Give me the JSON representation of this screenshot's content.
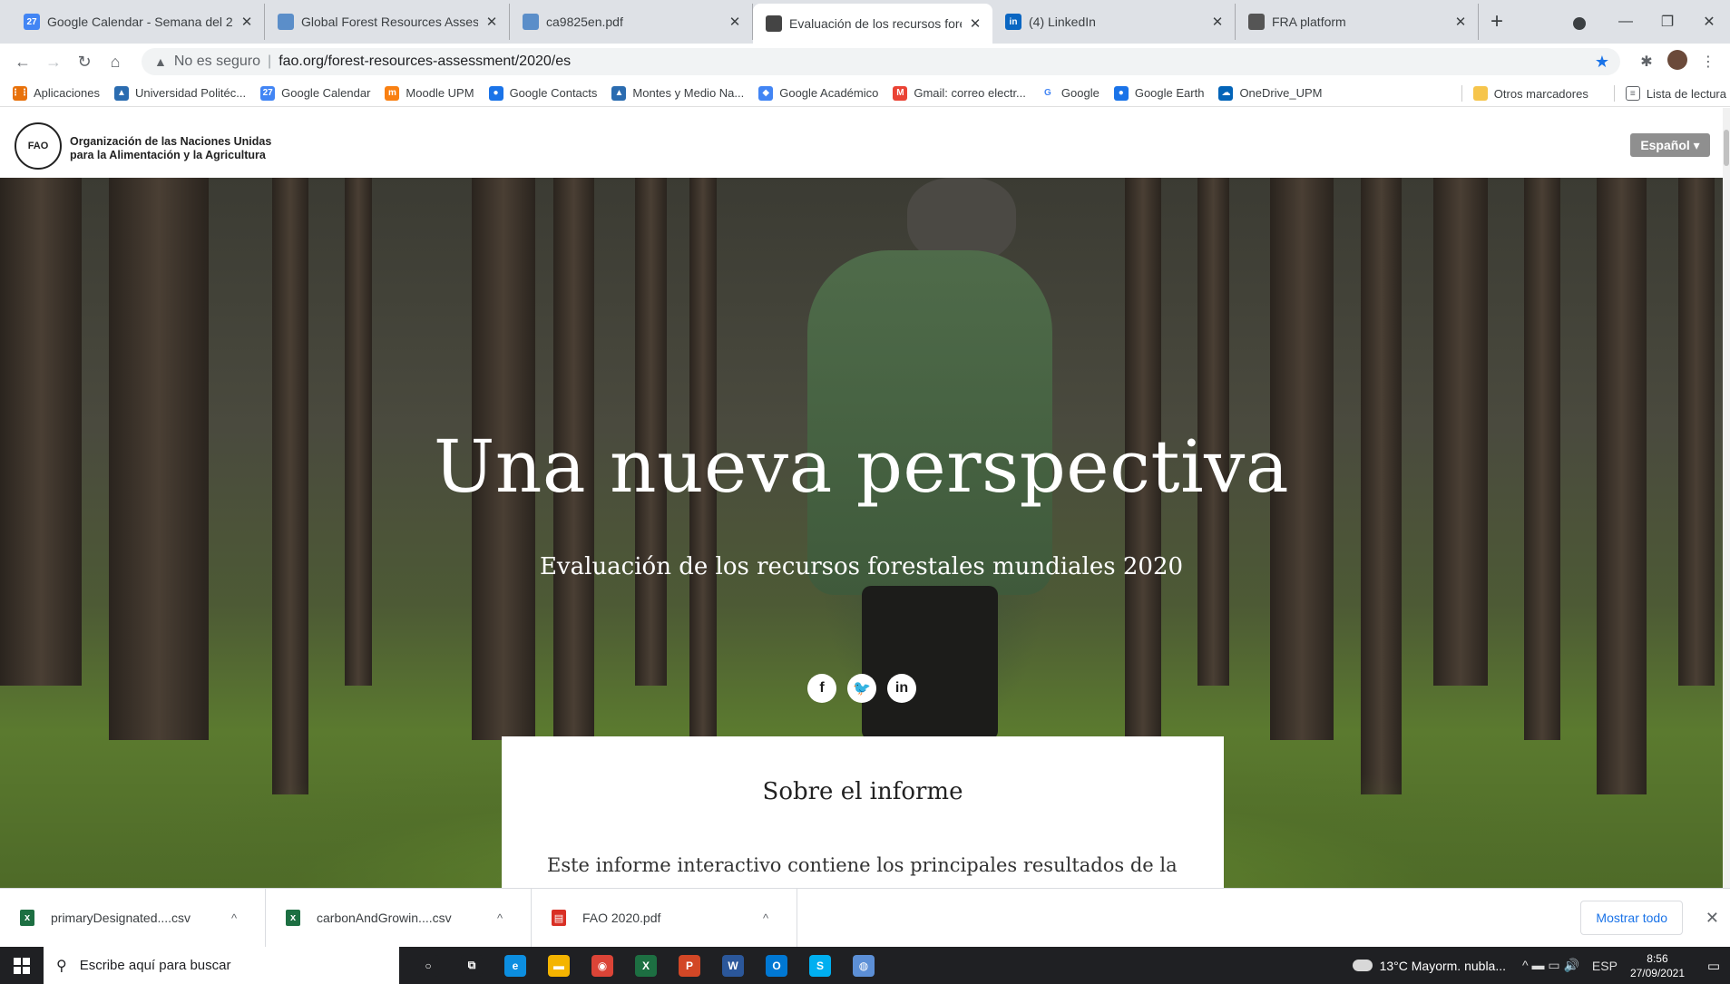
{
  "browser": {
    "tabs": [
      {
        "title": "Google Calendar - Semana del 2",
        "icon": "calendar-icon",
        "color": "#4285f4",
        "glyph": "27",
        "width": 280
      },
      {
        "title": "Global Forest Resources Assessm",
        "icon": "globe-icon",
        "color": "#5b8ec9",
        "glyph": "",
        "width": 270
      },
      {
        "title": "ca9825en.pdf",
        "icon": "globe-icon",
        "color": "#5b8ec9",
        "glyph": "",
        "width": 268
      },
      {
        "title": "Evaluación de los recursos forest",
        "icon": "fao-favicon-icon",
        "color": "#444444",
        "glyph": "",
        "width": 264,
        "active": true
      },
      {
        "title": "(4) LinkedIn",
        "icon": "linkedin-icon",
        "color": "#0a66c2",
        "glyph": "in",
        "width": 268
      },
      {
        "title": "FRA platform",
        "icon": "globe-icon",
        "color": "#555555",
        "glyph": "",
        "width": 268
      }
    ],
    "new_tab_label": "+",
    "address": {
      "security_icon": "warning-triangle-icon",
      "security_text": "No es seguro",
      "url": "fao.org/forest-resources-assessment/2020/es"
    },
    "bookmarks": [
      {
        "label": "Aplicaciones",
        "icon": "apps-grid-icon",
        "color": "#e8710a",
        "glyph": "⋮⋮"
      },
      {
        "label": "Universidad Politéc...",
        "icon": "upm-icon",
        "color": "#2b6cb0",
        "glyph": "▲"
      },
      {
        "label": "Google Calendar",
        "icon": "calendar-icon",
        "color": "#4285f4",
        "glyph": "27"
      },
      {
        "label": "Moodle UPM",
        "icon": "moodle-icon",
        "color": "#f98012",
        "glyph": "m"
      },
      {
        "label": "Google Contacts",
        "icon": "contacts-icon",
        "color": "#1a73e8",
        "glyph": "●"
      },
      {
        "label": "Montes y Medio Na...",
        "icon": "upm-icon",
        "color": "#2b6cb0",
        "glyph": "▲"
      },
      {
        "label": "Google Académico",
        "icon": "scholar-icon",
        "color": "#4285f4",
        "glyph": "◆"
      },
      {
        "label": "Gmail: correo electr...",
        "icon": "gmail-icon",
        "color": "#ea4335",
        "glyph": "M"
      },
      {
        "label": "Google",
        "icon": "google-icon",
        "color": "#ffffff",
        "glyph": "G"
      },
      {
        "label": "Google Earth",
        "icon": "earth-icon",
        "color": "#1a73e8",
        "glyph": "●"
      },
      {
        "label": "OneDrive_UPM",
        "icon": "onedrive-icon",
        "color": "#0364b8",
        "glyph": "☁"
      }
    ],
    "bookmarks_right": [
      {
        "label": "Otros marcadores",
        "icon": "folder-icon"
      },
      {
        "label": "Lista de lectura",
        "icon": "reading-list-icon"
      }
    ]
  },
  "site": {
    "org_name_line1": "Organización de las Naciones Unidas",
    "org_name_line2": "para la Alimentación y la Agricultura",
    "logo_text": "FAO",
    "language_button": "Español ▾",
    "hero_title": "Una nueva perspectiva",
    "hero_subtitle": "Evaluación de los recursos forestales mundiales 2020",
    "social": [
      {
        "glyph": "f",
        "icon": "facebook-icon"
      },
      {
        "glyph": "t",
        "icon": "twitter-icon"
      },
      {
        "glyph": "in",
        "icon": "linkedin-icon"
      }
    ],
    "card_title": "Sobre el informe",
    "card_text": "Este informe interactivo contiene los principales resultados de la"
  },
  "downloads": {
    "items": [
      {
        "name": "primaryDesignated....csv",
        "icon": "excel-file-icon",
        "color": "#1d6f42",
        "glyph": "x"
      },
      {
        "name": "carbonAndGrowin....csv",
        "icon": "excel-file-icon",
        "color": "#1d6f42",
        "glyph": "x"
      },
      {
        "name": "FAO 2020.pdf",
        "icon": "pdf-file-icon",
        "color": "#d93025",
        "glyph": "▤"
      }
    ],
    "show_all": "Mostrar todo"
  },
  "taskbar": {
    "search_placeholder": "Escribe aquí para buscar",
    "apps": [
      {
        "name": "cortana",
        "icon": "cortana-icon",
        "color": "#1f2023",
        "glyph": "○"
      },
      {
        "name": "task-view",
        "icon": "task-view-icon",
        "color": "#1f2023",
        "glyph": "⧉"
      },
      {
        "name": "edge",
        "icon": "edge-icon",
        "color": "#0c8ee0",
        "glyph": "e"
      },
      {
        "name": "explorer",
        "icon": "file-explorer-icon",
        "color": "#f4b400",
        "glyph": "▬"
      },
      {
        "name": "chrome",
        "icon": "chrome-icon",
        "color": "#db4437",
        "glyph": "◉"
      },
      {
        "name": "excel",
        "icon": "excel-icon",
        "color": "#1d6f42",
        "glyph": "X"
      },
      {
        "name": "powerpoint",
        "icon": "powerpoint-icon",
        "color": "#d24726",
        "glyph": "P"
      },
      {
        "name": "word",
        "icon": "word-icon",
        "color": "#2b579a",
        "glyph": "W"
      },
      {
        "name": "outlook",
        "icon": "outlook-icon",
        "color": "#0078d4",
        "glyph": "O"
      },
      {
        "name": "skype",
        "icon": "skype-icon",
        "color": "#00aff0",
        "glyph": "S"
      },
      {
        "name": "earth",
        "icon": "earth-icon",
        "color": "#5c8fd6",
        "glyph": "◍"
      }
    ],
    "weather": "13°C  Mayorm. nubla...",
    "system_icons": "^  ▬  ▭  🔊",
    "language": "ESP",
    "time": "8:56",
    "date": "27/09/2021"
  }
}
